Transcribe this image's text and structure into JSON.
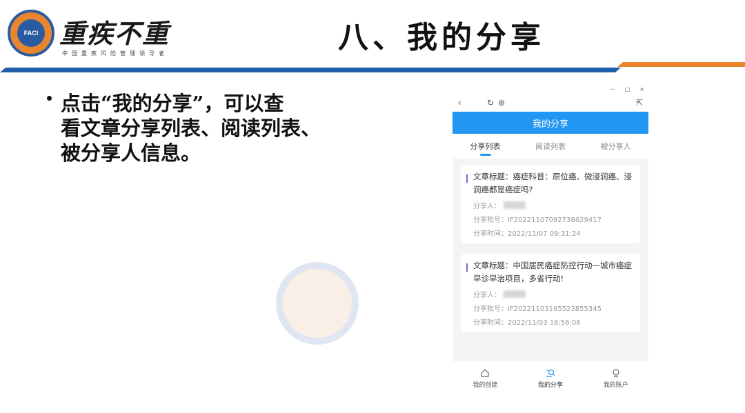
{
  "header": {
    "brand": "重疾不重",
    "brand_sub": "中国重疾风险管理领导者",
    "logo_text": "FACI",
    "slide_title": "八、我的分享"
  },
  "bullet": {
    "line1": "点击“我的分享”，可以查",
    "line2": "看文章分享列表、阅读列表、",
    "line3": "被分享人信息。"
  },
  "phone": {
    "window_controls": [
      "－",
      "□",
      "×"
    ],
    "app_title": "我的分享",
    "tabs": [
      "分享列表",
      "阅读列表",
      "被分享人"
    ],
    "active_tab": "分享列表",
    "accent_color": "#2196f3",
    "cards": [
      {
        "title": "文章标题：癌症科普：原位癌、微浸润癌、浸润癌都是癌症吗?",
        "sharer_label": "分享人：",
        "batch": "分享批号：IF20221107092738629417",
        "time": "分享时间：2022/11/07 09:31:24"
      },
      {
        "title": "文章标题：中国居民癌症防控行动—城市癌症早诊早治项目，多省行动!",
        "sharer_label": "分享人：",
        "batch": "分享批号：IF20221103165523855345",
        "time": "分享时间：2022/11/03 16:56:06"
      }
    ],
    "bottom_nav": [
      "我的创建",
      "我的分享",
      "我的账户"
    ]
  }
}
